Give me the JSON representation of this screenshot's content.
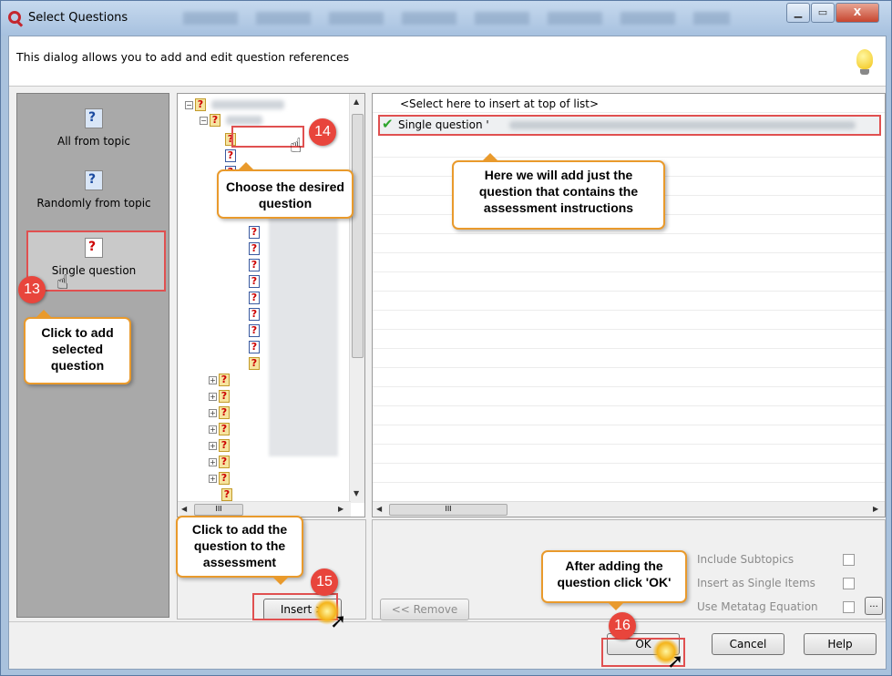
{
  "window": {
    "title": "Select Questions",
    "min_glyph": "▁",
    "max_glyph": "▭",
    "close_glyph": "X"
  },
  "header": {
    "text": "This dialog allows you to add and edit question references"
  },
  "left_panel": {
    "items": [
      {
        "label": "All from topic",
        "icon": "question-icon"
      },
      {
        "label": "Randomly from topic",
        "icon": "dice-question-icon"
      },
      {
        "label": "Single question",
        "icon": "single-question-icon"
      }
    ]
  },
  "list": {
    "top_item": "<Select here to insert at top of list>",
    "selected_item": "Single question '"
  },
  "tree": {
    "hscroll_glyph": "III"
  },
  "list_scroll": {
    "hscroll_glyph": "III"
  },
  "buttons": {
    "insert": "Insert >",
    "remove": "<< Remove",
    "ellipsis": "...",
    "ok": "OK",
    "cancel": "Cancel",
    "help": "Help"
  },
  "options": {
    "include_subtopics": "Include Subtopics",
    "insert_single_items": "Insert as Single Items",
    "use_metatag": "Use Metatag Equation"
  },
  "annotations": {
    "callout_13": "Click to add selected question",
    "callout_14": "Choose the desired question",
    "callout_list": "Here we will add just the question that contains the assessment instructions",
    "callout_15": "Click to add the question to the assessment",
    "callout_16": "After adding the question click 'OK'",
    "badge_13": "13",
    "badge_14": "14",
    "badge_15": "15",
    "badge_16": "16"
  },
  "colors": {
    "highlight": "#e05050",
    "callout_border": "#e99a2c",
    "badge": "#e8453c",
    "left_panel_bg": "#a9a9a9"
  }
}
